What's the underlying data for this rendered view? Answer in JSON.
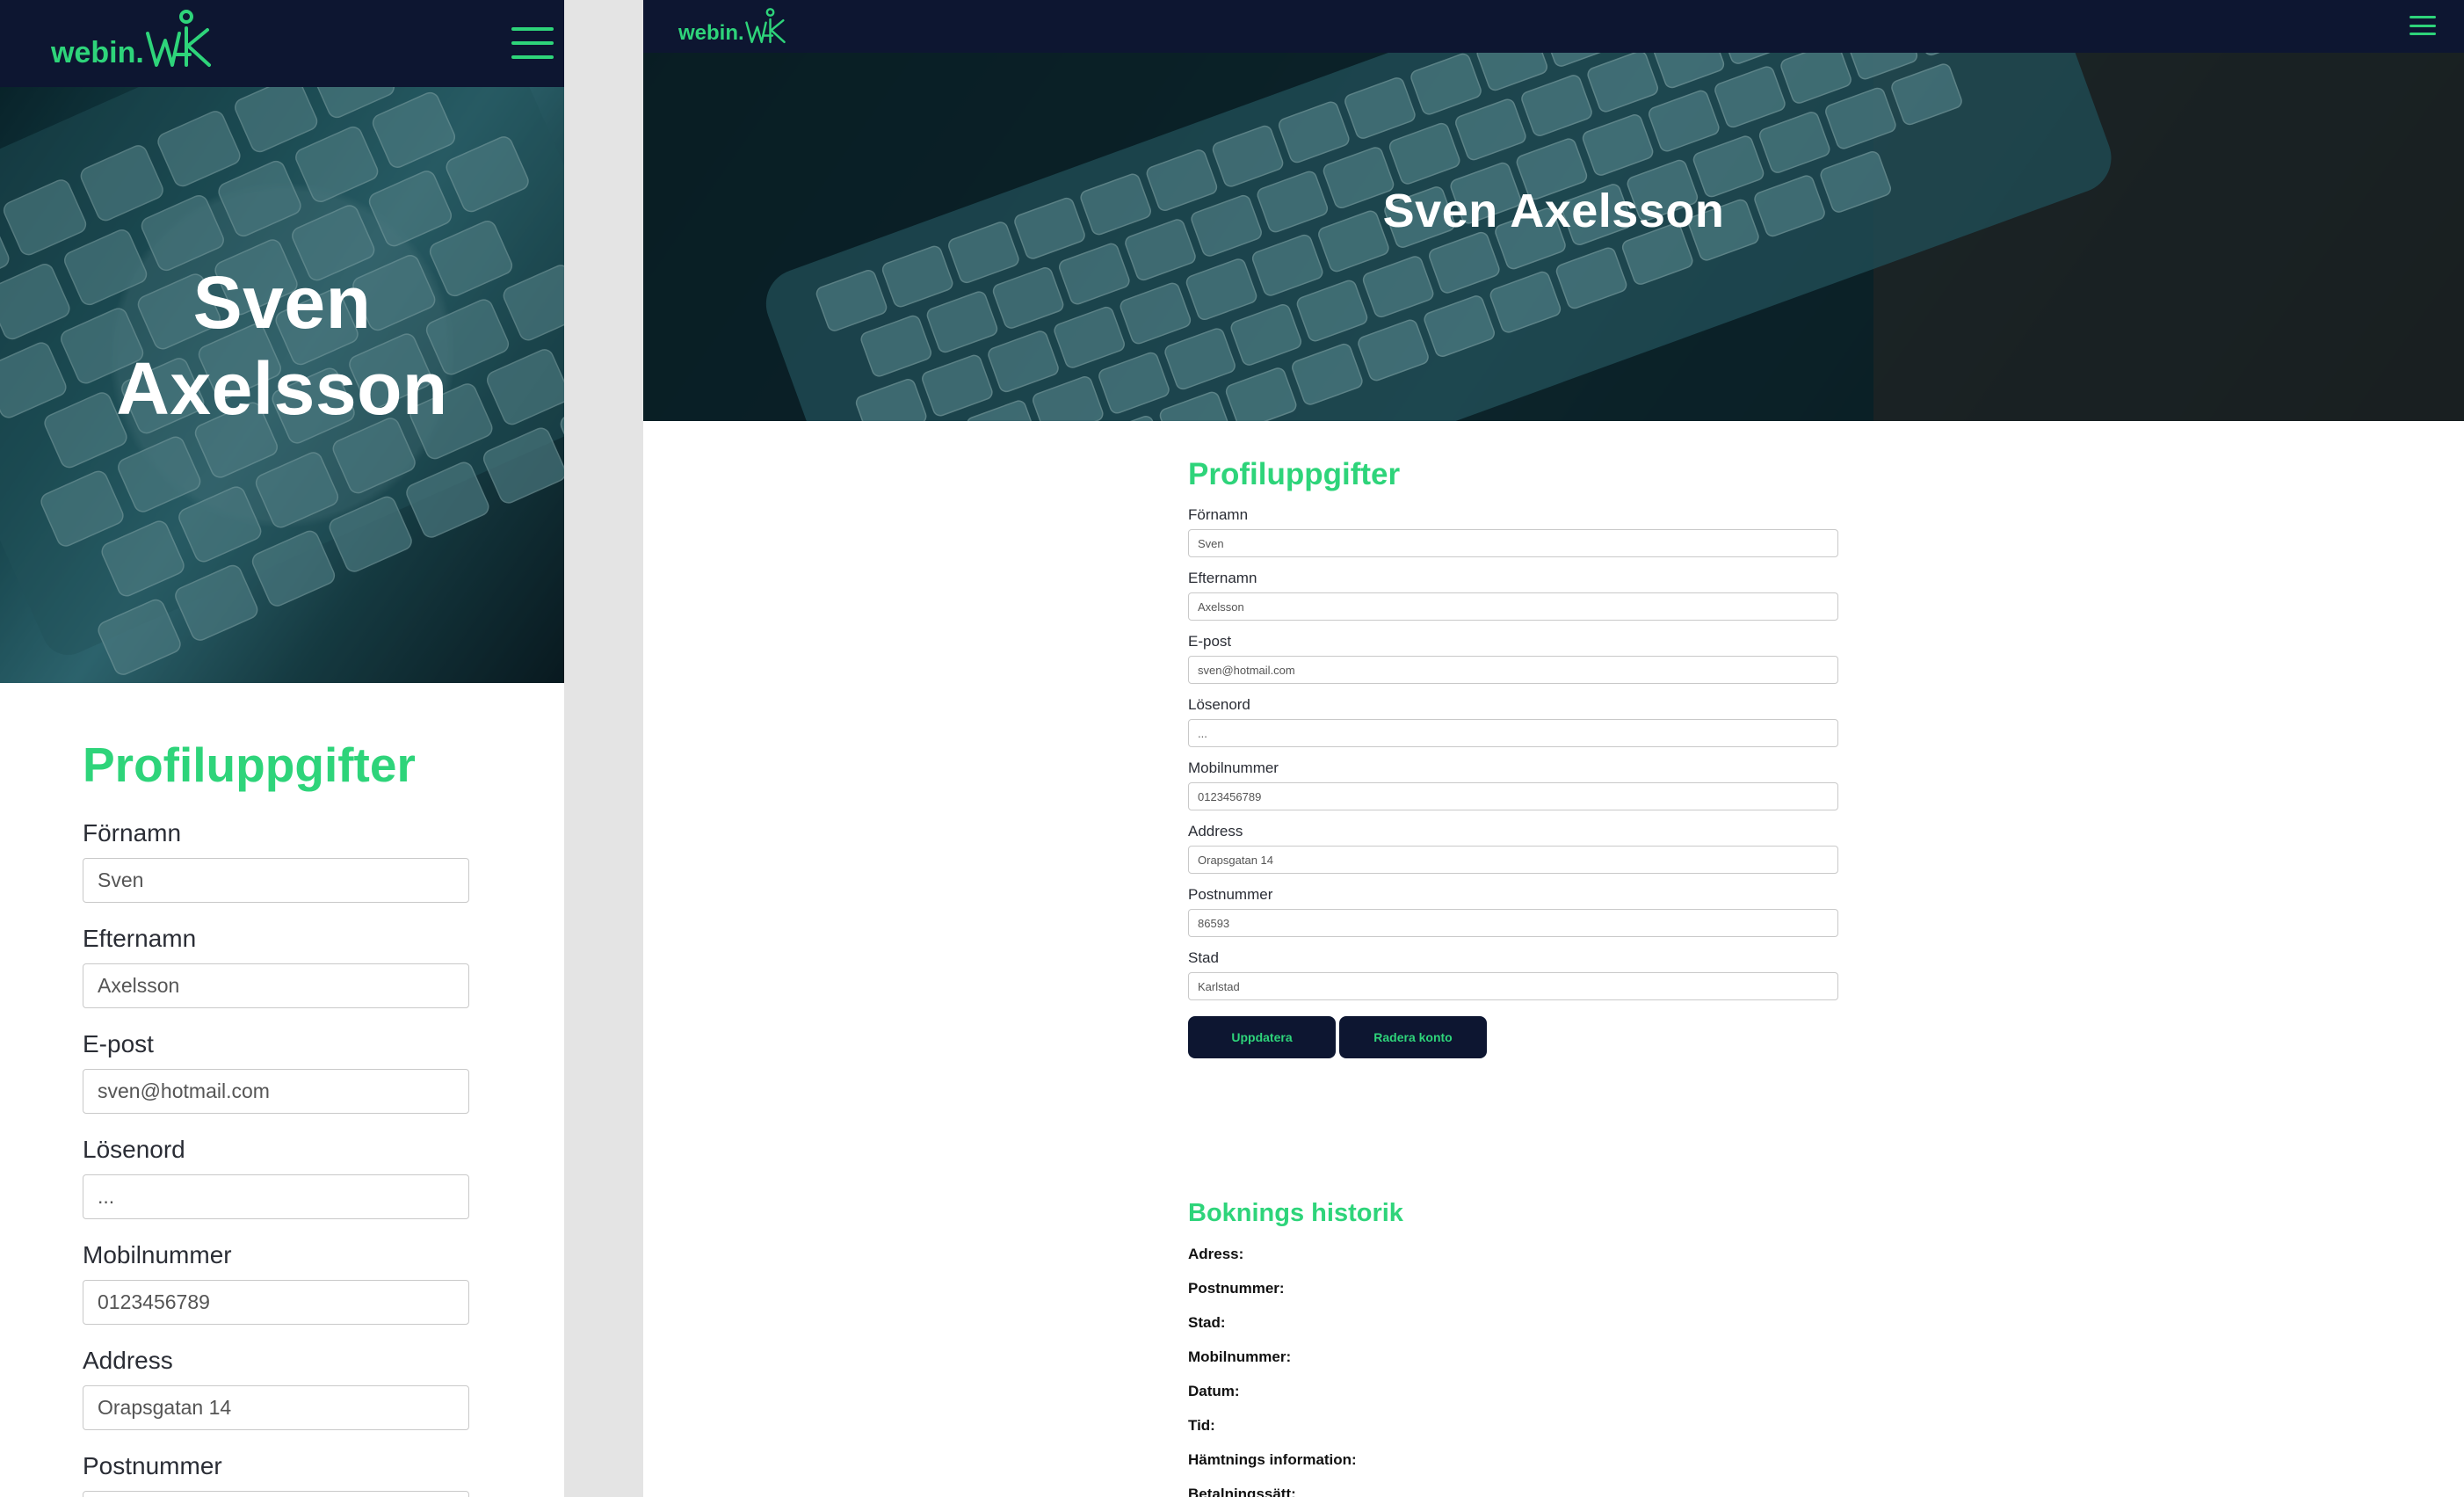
{
  "brand": {
    "logo_text": "webin.",
    "accent": "#2ed47a",
    "nav_bg": "#0d1631"
  },
  "profile": {
    "name": "Sven Axelsson",
    "name_line1": "Sven",
    "name_line2": "Axelsson"
  },
  "form": {
    "title": "Profiluppgifter",
    "fields": [
      {
        "label": "Förnamn",
        "value": "Sven"
      },
      {
        "label": "Efternamn",
        "value": "Axelsson"
      },
      {
        "label": "E-post",
        "value": "sven@hotmail.com"
      },
      {
        "label": "Lösenord",
        "value": "..."
      },
      {
        "label": "Mobilnummer",
        "value": "0123456789"
      },
      {
        "label": "Address",
        "value": "Orapsgatan 14"
      },
      {
        "label": "Postnummer",
        "value": "86593"
      },
      {
        "label": "Stad",
        "value": "Karlstad"
      }
    ],
    "update_label": "Uppdatera",
    "delete_label": "Radera konto"
  },
  "history": {
    "title": "Boknings historik",
    "rows": [
      "Adress:",
      "Postnummer:",
      "Stad:",
      "Mobilnummer:",
      "Datum:",
      "Tid:",
      "Hämtnings information:",
      "Betalningssätt:"
    ]
  },
  "icons": {
    "menu": "hamburger-menu-icon",
    "logo": "webin-logo-icon"
  }
}
